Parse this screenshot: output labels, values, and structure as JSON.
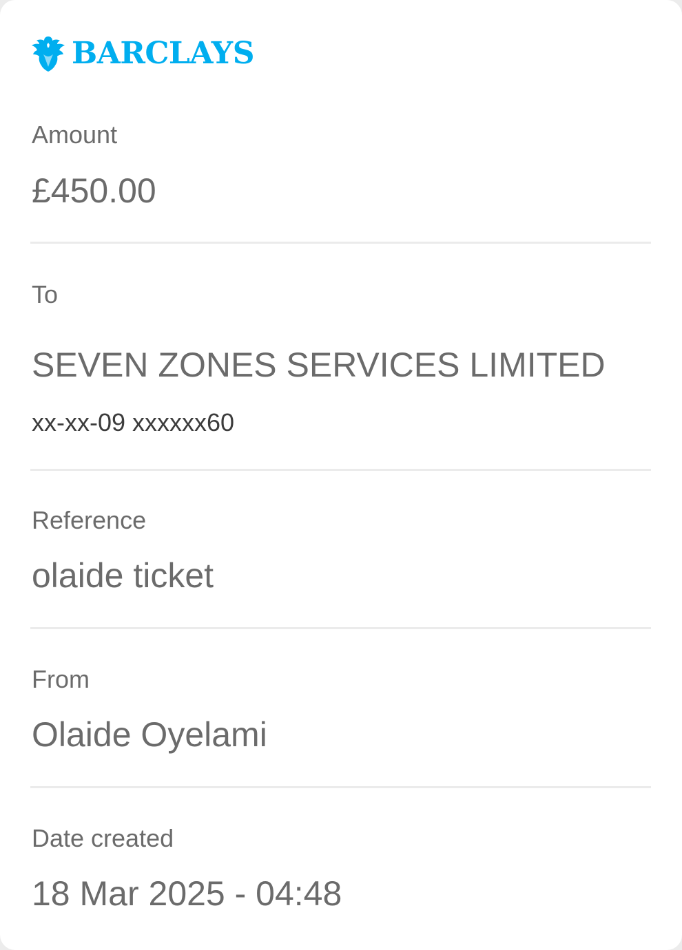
{
  "brand": {
    "name": "BARCLAYS",
    "logo_icon": "eagle-icon",
    "color": "#00aeef"
  },
  "details": {
    "amount": {
      "label": "Amount",
      "value": "£450.00"
    },
    "to": {
      "label": "To",
      "value": "SEVEN ZONES SERVICES LIMITED",
      "account": "xx-xx-09 xxxxxx60"
    },
    "reference": {
      "label": "Reference",
      "value": "olaide ticket"
    },
    "from": {
      "label": "From",
      "value": "Olaide Oyelami"
    },
    "date_created": {
      "label": "Date created",
      "value": "18 Mar 2025 - 04:48"
    }
  }
}
